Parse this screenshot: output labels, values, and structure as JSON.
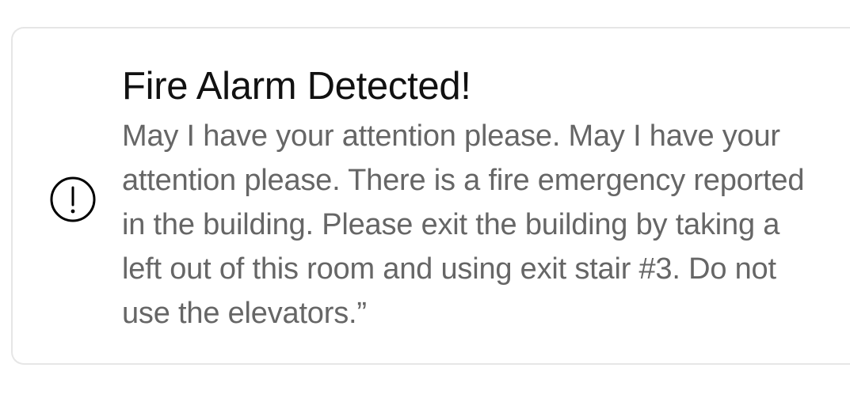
{
  "alert": {
    "icon": "exclamation-circle-icon",
    "title": "Fire Alarm Detected!",
    "message": "May I have your attention please. May I have your attention please. There is a fire emergency reported in the building. Please exit the building by taking a left out of this room and using exit stair #3. Do not use the elevators.”"
  },
  "colors": {
    "title": "#111111",
    "message": "#666666",
    "border": "#e6e6e6",
    "icon": "#000000"
  }
}
